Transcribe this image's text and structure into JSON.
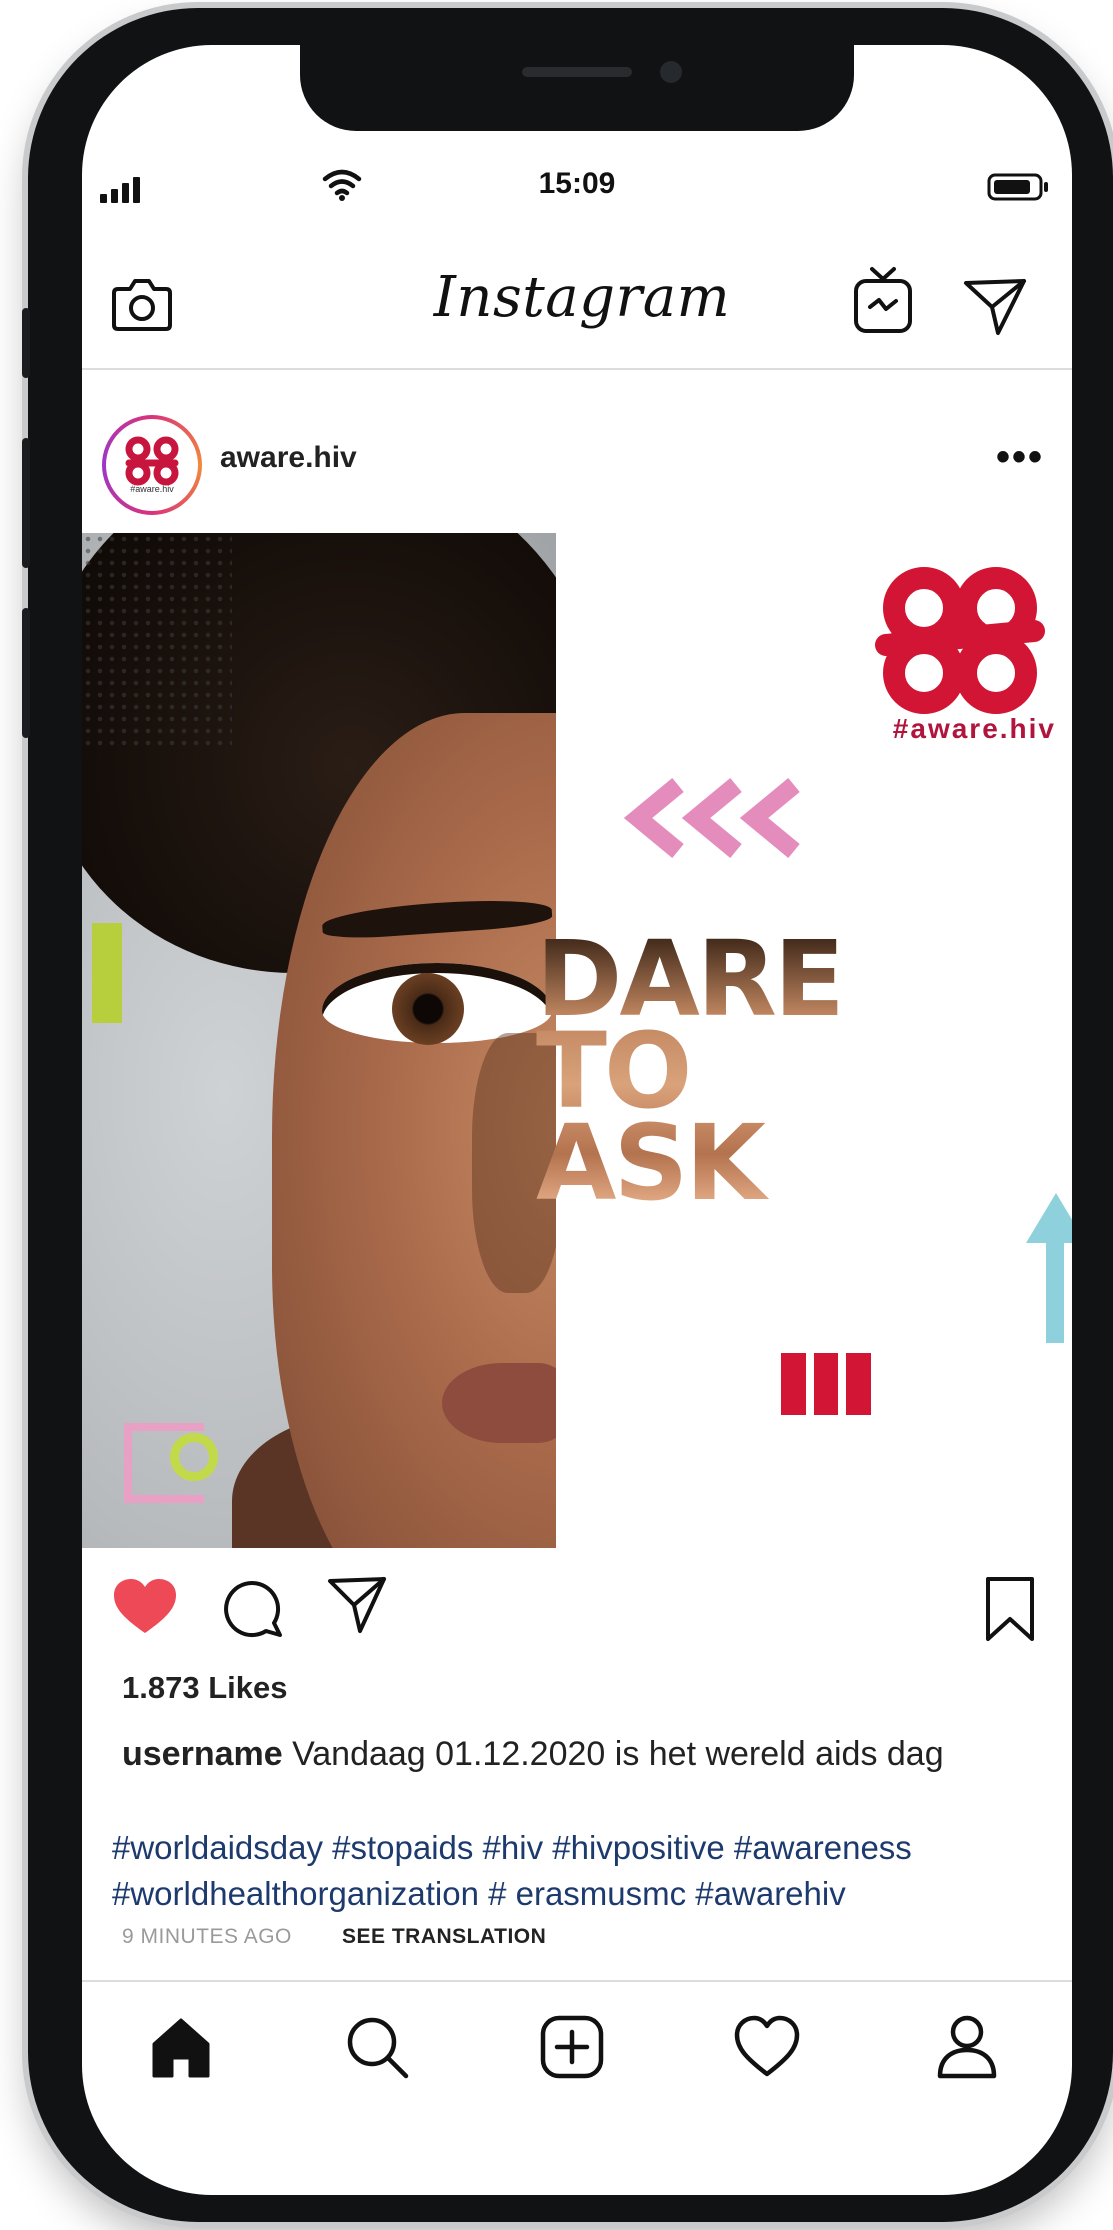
{
  "status_bar": {
    "time": "15:09",
    "icons": [
      "signal-icon",
      "wifi-icon",
      "battery-icon"
    ]
  },
  "header": {
    "app_name": "Instagram",
    "icons": [
      "camera-icon",
      "igtv-icon",
      "direct-message-icon"
    ]
  },
  "post": {
    "username": "aware.hiv",
    "avatar_caption": "#aware.hiv",
    "image": {
      "brand_hashtag": "#aware.hiv",
      "headline_lines": [
        "DARE",
        "TO",
        "ASK"
      ],
      "colors": {
        "brand_red": "#d21535",
        "chevron_pink": "#e48cbc",
        "accent_green": "#b7cf3d",
        "accent_cyan": "#8ed0dc"
      }
    },
    "actions": {
      "icons": [
        "heart-icon",
        "comment-icon",
        "share-icon",
        "bookmark-icon"
      ],
      "like_color": "#ed4956"
    },
    "likes": "1.873 Likes",
    "caption": {
      "username": "username",
      "text": "Vandaag 01.12.2020 is het wereld aids dag"
    },
    "hashtags": [
      "#worldaidsday #stopaids #hiv #hivpositive #awareness",
      "#worldhealthorganization # erasmusmc #awarehiv"
    ],
    "time_ago": "9 MINUTES AGO",
    "see_translation": "SEE TRANSLATION"
  },
  "tab_bar": {
    "tabs": [
      "home-icon",
      "search-icon",
      "new-post-icon",
      "activity-icon",
      "profile-icon"
    ]
  }
}
